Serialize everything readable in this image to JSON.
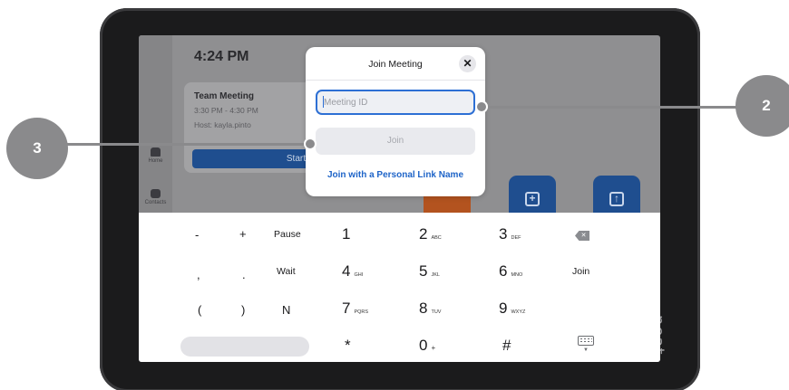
{
  "home": {
    "clock": "4:24 PM",
    "meeting_card": {
      "title": "Team Meeting",
      "time": "3:30 PM - 4:30 PM",
      "host": "Host: kayla.pinto",
      "start_label": "Start"
    },
    "sidebar": [
      {
        "label": "Home",
        "icon": "home-icon"
      },
      {
        "label": "Contacts",
        "icon": "contacts-icon"
      }
    ]
  },
  "dialog": {
    "title": "Join Meeting",
    "close_icon": "close-icon",
    "meeting_id": {
      "value": "",
      "placeholder": "Meeting ID"
    },
    "join_label": "Join",
    "personal_link_label": "Join with a Personal Link Name"
  },
  "keyboard": {
    "row1": [
      "-",
      "+",
      "Pause"
    ],
    "row2": [
      ",",
      ".",
      "Wait"
    ],
    "row3": [
      "(",
      ")",
      "N"
    ],
    "keys": [
      {
        "num": "1",
        "sub": ""
      },
      {
        "num": "2",
        "sub": "ABC"
      },
      {
        "num": "3",
        "sub": "DEF"
      },
      {
        "num": "4",
        "sub": "GHI"
      },
      {
        "num": "5",
        "sub": "JKL"
      },
      {
        "num": "6",
        "sub": "MNO"
      },
      {
        "num": "7",
        "sub": "PQRS"
      },
      {
        "num": "8",
        "sub": "TUV"
      },
      {
        "num": "9",
        "sub": "WXYZ"
      },
      {
        "num": "*",
        "sub": ""
      },
      {
        "num": "0",
        "sub": "+"
      },
      {
        "num": "#",
        "sub": ""
      }
    ],
    "join_label": "Join",
    "backspace_icon": "backspace-icon",
    "keyboard_icon": "keyboard-icon"
  },
  "device": {
    "brand": "neat."
  },
  "callouts": [
    "3",
    "2"
  ],
  "colors": {
    "accent": "#2d6fd4",
    "link": "#1e64c8",
    "start_button": "#1f4e8f",
    "callout": "#8a8a8c"
  }
}
